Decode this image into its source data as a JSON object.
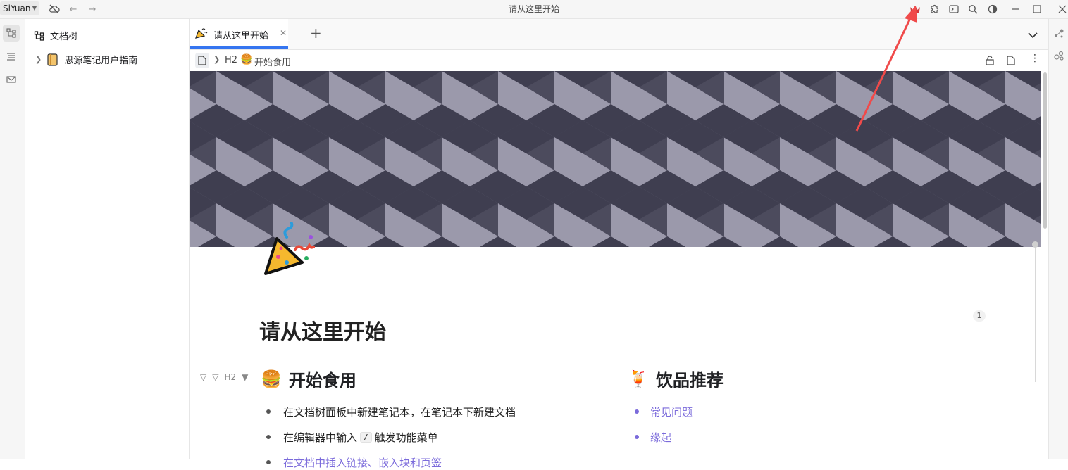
{
  "app": {
    "workspace_label": "SiYuan",
    "window_title": "请从这里开始"
  },
  "filetree": {
    "header": "文档树",
    "notebooks": [
      {
        "name": "思源笔记用户指南"
      }
    ]
  },
  "tabs": [
    {
      "title": "请从这里开始",
      "icon": "party-popper-icon"
    }
  ],
  "breadcrumb": {
    "heading_marker": "H2",
    "heading_title": "开始食用"
  },
  "doc": {
    "title": "请从这里开始",
    "backlink_count": "1",
    "gutter_label": "H2",
    "col1": {
      "heading": "开始食用",
      "items": [
        {
          "text": "在文档树面板中新建笔记本，在笔记本下新建文档"
        },
        {
          "text_before": "在编辑器中输入",
          "code": "/",
          "text_after": "触发功能菜单"
        },
        {
          "text": "在文档中插入链接、嵌入块和页签"
        }
      ]
    },
    "col2": {
      "heading": "饮品推荐",
      "items": [
        {
          "text": "常见问题"
        },
        {
          "text": "缘起"
        }
      ]
    }
  },
  "colors": {
    "accent": "#3575f0",
    "link": "#7b6bdb",
    "annotation_arrow": "#f04a4a",
    "crown": "#d23b3b"
  }
}
